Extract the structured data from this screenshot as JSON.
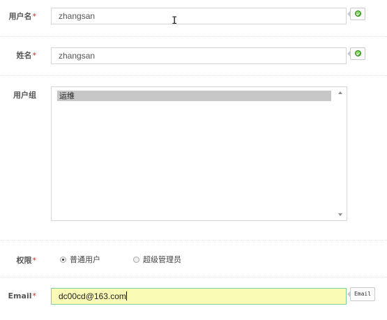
{
  "form": {
    "username": {
      "label": "用户名",
      "required_mark": "*",
      "value": "zhangsan"
    },
    "fullname": {
      "label": "姓名",
      "required_mark": "*",
      "value": "zhangsan"
    },
    "group": {
      "label": "用户组",
      "options": [
        {
          "label": "运维",
          "selected": true
        }
      ]
    },
    "permission": {
      "label": "权限",
      "required_mark": "*",
      "options": [
        {
          "label": "普通用户",
          "checked": true
        },
        {
          "label": "超级管理员",
          "checked": false
        }
      ]
    },
    "email": {
      "label": "Email",
      "required_mark": "*",
      "value": "dc00cd@163.com",
      "hint": "Email"
    }
  },
  "colors": {
    "required": "#e02020",
    "active_input_bg": "#fafcb6",
    "active_input_border": "#7ecf9a",
    "ok_icon": "#3aa11c",
    "selected_option_bg": "#c7c7c7"
  },
  "icons": {
    "validation_ok": "check-circle-icon",
    "cursor": "text-cursor-icon"
  }
}
